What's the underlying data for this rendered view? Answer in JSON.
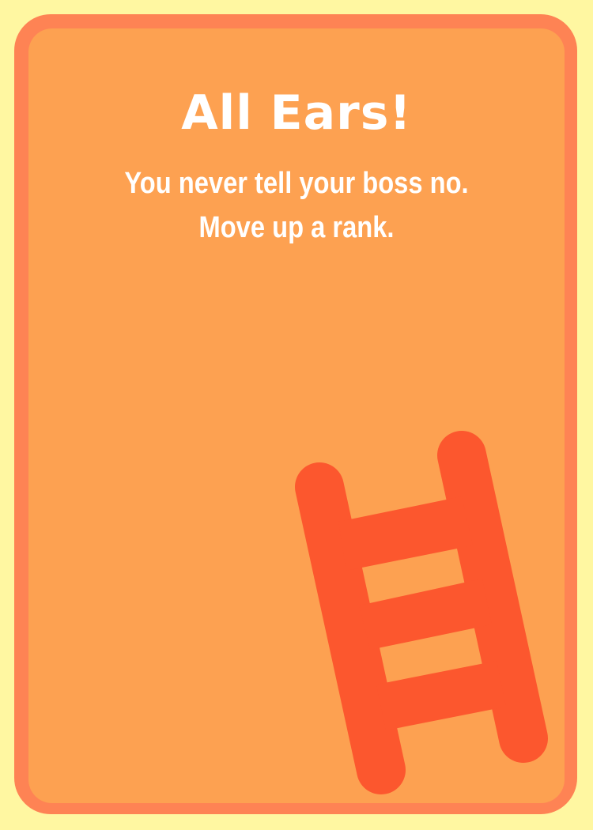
{
  "card": {
    "title": "All Ears!",
    "lines": [
      "You never tell your boss no.",
      "Move up a rank."
    ],
    "icon": "ladder-icon"
  },
  "colors": {
    "background": "#fff7a1",
    "card_border": "#fe8354",
    "card_face": "#fda151",
    "ladder": "#fc572e",
    "text": "#ffffff"
  }
}
